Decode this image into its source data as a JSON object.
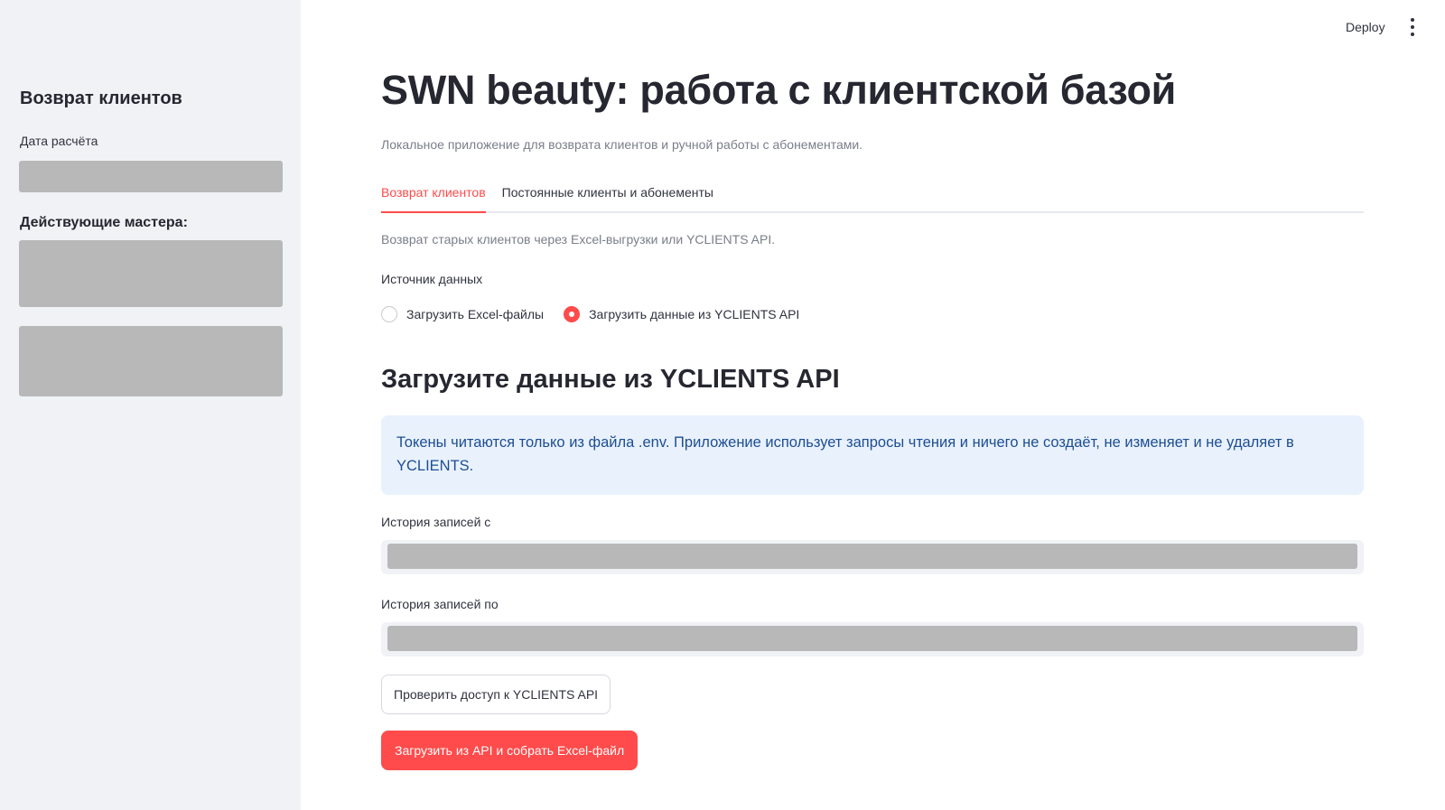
{
  "header": {
    "deploy_label": "Deploy",
    "menu_icon": "vertical-ellipsis-icon"
  },
  "sidebar": {
    "title": "Возврат клиентов",
    "date_label": "Дата расчёта",
    "masters_label": "Действующие мастера:"
  },
  "main": {
    "title": "SWN beauty: работа с клиентской базой",
    "caption": "Локальное приложение для возврата клиентов и ручной работы с абонементами.",
    "tabs": [
      {
        "label": "Возврат клиентов",
        "active": true
      },
      {
        "label": "Постоянные клиенты и абонементы",
        "active": false
      }
    ],
    "tab_description": "Возврат старых клиентов через Excel-выгрузки или YCLIENTS API.",
    "source": {
      "label": "Источник данных",
      "options": [
        {
          "label": "Загрузить Excel-файлы",
          "selected": false
        },
        {
          "label": "Загрузить данные из YCLIENTS API",
          "selected": true
        }
      ]
    },
    "section_title": "Загрузите данные из YCLIENTS API",
    "info_text": "Токены читаются только из файла .env. Приложение использует запросы чтения и ничего не создаёт, не изменяет и не удаляет в YCLIENTS.",
    "history_from_label": "История записей с",
    "history_to_label": "История записей по",
    "check_button_label": "Проверить доступ к YCLIENTS API",
    "load_button_label": "Загрузить из API и собрать Excel-файл"
  },
  "colors": {
    "accent": "#ff4b4b",
    "sidebar_bg": "#f0f2f6",
    "info_bg": "#e9f1fd",
    "info_text": "#1c4e92",
    "redacted": "#b8b8b8"
  }
}
